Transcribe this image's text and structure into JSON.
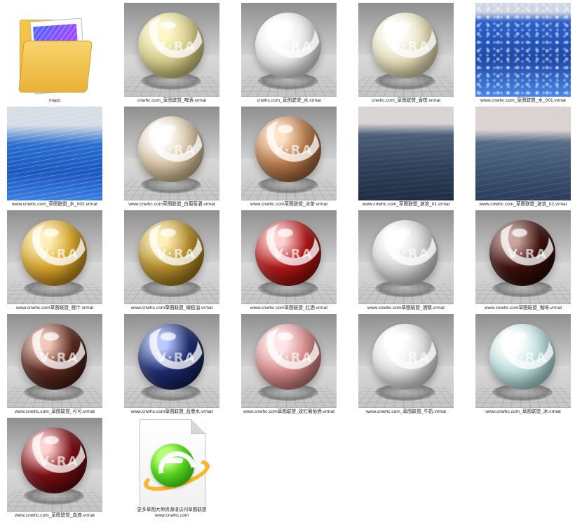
{
  "items": [
    {
      "label": "maps",
      "kind": "folder"
    },
    {
      "label": "cnwhc.com_草图联盟_啤酒.vrmat",
      "kind": "sphere",
      "colors": {
        "base": "#d7d08e",
        "band": "#f2f2f2"
      }
    },
    {
      "label": "cnwhc.com_草图联盟_水.vrmat",
      "kind": "sphere",
      "colors": {
        "base": "#e7e7e7",
        "band": "#ffffff"
      }
    },
    {
      "label": "cnwhc.com_草图联盟_香槟.vrmat",
      "kind": "sphere",
      "colors": {
        "base": "#e7e1bd",
        "band": "#ffffff"
      }
    },
    {
      "label": "www.cnwhc.com_草图联盟_水_001.vrmat",
      "kind": "water1"
    },
    {
      "label": "www.cnwhc.com_草图联盟_水_002.vrmat",
      "kind": "water2"
    },
    {
      "label": "www.cnwhc.com草图联盟_白葡萄酒.vrmat",
      "kind": "sphere",
      "colors": {
        "base": "#d9c7a7",
        "band": "#ffffff"
      }
    },
    {
      "label": "www.cnwhc.com草图联盟_冰茶.vrmat",
      "kind": "sphere",
      "colors": {
        "base": "#b77a4a",
        "band": "#ffffff"
      }
    },
    {
      "label": "www.cnwhc.com_草图联盟_波浪_01.vrmat",
      "kind": "wave1"
    },
    {
      "label": "www.cnwhc.com_草图联盟_波浪_02.vrmat",
      "kind": "wave2"
    },
    {
      "label": "www.cnwhc.com草图联盟_橙汁.vrmat",
      "kind": "sphere",
      "colors": {
        "base": "#d6a42a",
        "band": "#ffffff"
      }
    },
    {
      "label": "www.cnwhc.com草图联盟_橄榄油.vrmat",
      "kind": "sphere",
      "colors": {
        "base": "#b48d2a",
        "band": "#ffffff"
      }
    },
    {
      "label": "www.cnwhc.com草图联盟_红酒.vrmat",
      "kind": "sphere",
      "colors": {
        "base": "#b01717",
        "band": "#ffffff"
      }
    },
    {
      "label": "www.cnwhc.com草图联盟_酒精.vrmat",
      "kind": "sphere",
      "colors": {
        "base": "#d6d6d6",
        "band": "#ffffff"
      }
    },
    {
      "label": "www.cnwhc.com草图联盟_咖啡.vrmat",
      "kind": "sphere",
      "colors": {
        "base": "#3b0f0b",
        "band": "#ffffff"
      }
    },
    {
      "label": "www.cnwhc.com_草图联盟_可可.vrmat",
      "kind": "sphere",
      "colors": {
        "base": "#5b2a1e",
        "band": "#ffffff"
      }
    },
    {
      "label": "www.cnwhc.com草图联盟_蓝墨水.vrmat",
      "kind": "sphere",
      "colors": {
        "base": "#1c2b6d",
        "band": "#ffffff"
      }
    },
    {
      "label": "www.cnwhc.com草图联盟_玫红葡萄酒.vrmat",
      "kind": "sphere",
      "colors": {
        "base": "#d88d8d",
        "band": "#ffffff"
      }
    },
    {
      "label": "www.cnwhc.com_草图联盟_牛奶.vrmat",
      "kind": "sphere",
      "colors": {
        "base": "#e2e2e2",
        "band": "#ffffff"
      }
    },
    {
      "label": "www.cnwhc.com_草图联盟_冰.vrmat",
      "kind": "sphere",
      "colors": {
        "base": "#bfe1df",
        "band": "#ffffff"
      }
    },
    {
      "label": "www.cnwhc.com_草图联盟_血液.vrmat",
      "kind": "sphere",
      "colors": {
        "base": "#7a0f12",
        "band": "#ffffff"
      }
    },
    {
      "label": "更多草图大师资源请访问草图联盟\nwww.cnwhc.com",
      "kind": "doc"
    }
  ]
}
